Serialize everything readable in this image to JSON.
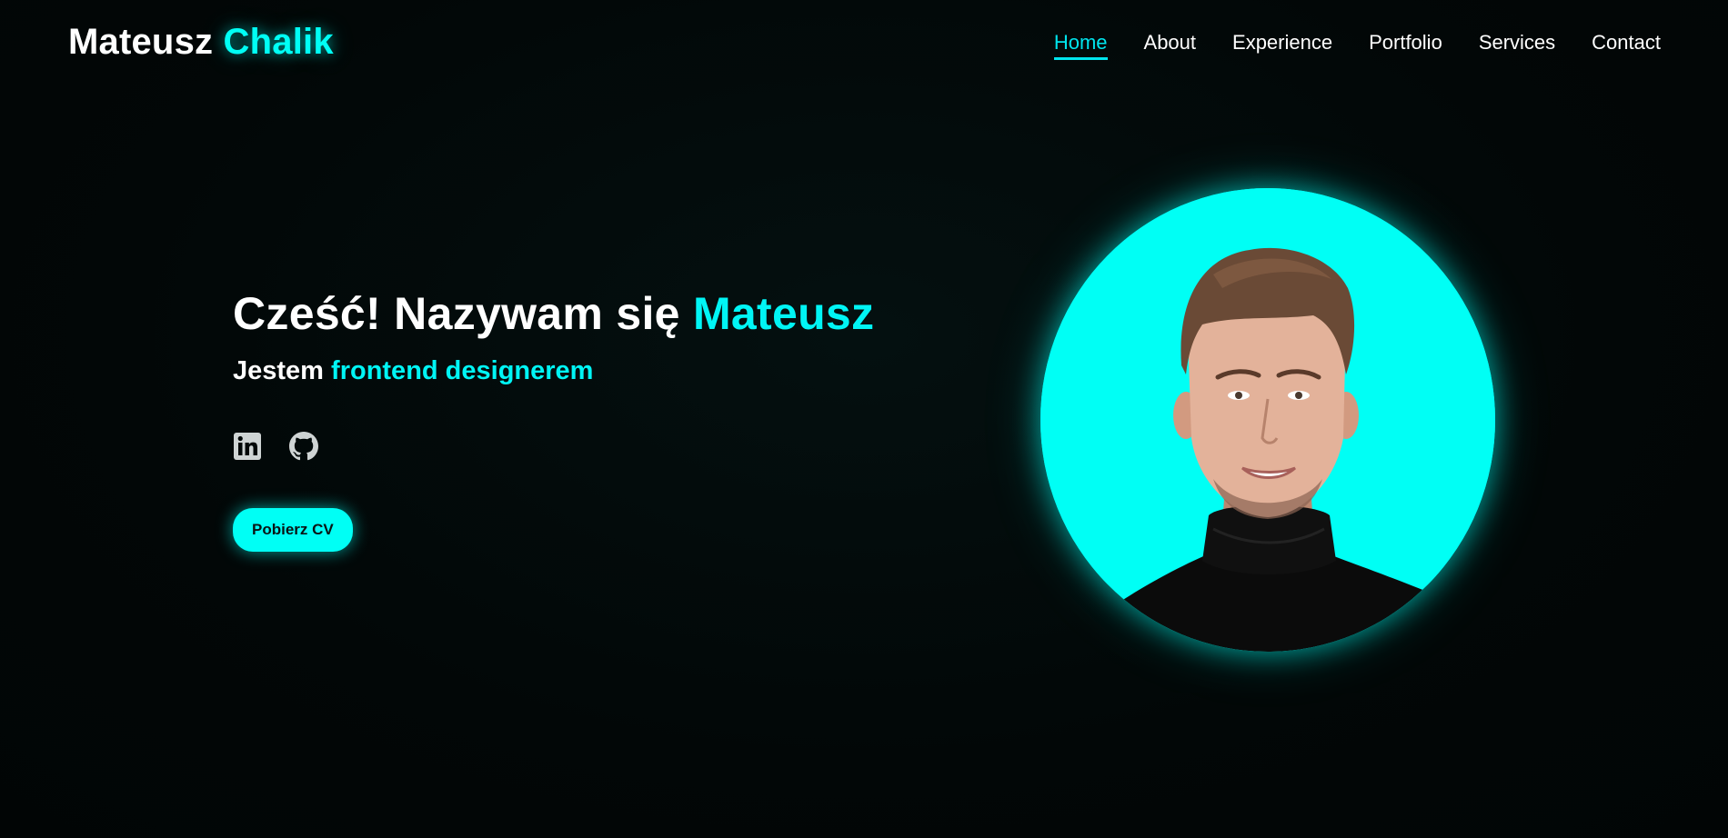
{
  "header": {
    "logo_first": "Mateusz",
    "logo_accent": "Chalik"
  },
  "nav": {
    "items": [
      {
        "label": "Home",
        "active": true
      },
      {
        "label": "About"
      },
      {
        "label": "Experience"
      },
      {
        "label": "Portfolio"
      },
      {
        "label": "Services"
      },
      {
        "label": "Contact"
      }
    ]
  },
  "hero": {
    "title_prefix": "Cześć! Nazywam się",
    "title_accent": "Mateusz",
    "subtitle_prefix": "Jestem",
    "subtitle_accent": "frontend designerem",
    "cv_button": "Pobierz CV",
    "socials": [
      {
        "icon": "linkedin-icon"
      },
      {
        "icon": "github-icon"
      }
    ]
  },
  "colors": {
    "accent": "#00fff5",
    "background": "#020808"
  }
}
